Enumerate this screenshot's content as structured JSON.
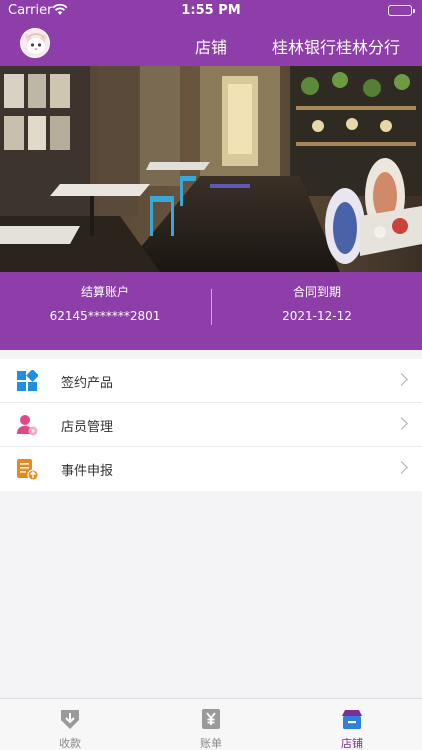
{
  "status_bar": {
    "carrier": "Carrier",
    "time": "1:55 PM"
  },
  "nav": {
    "title": "店铺",
    "bank_name": "桂林银行桂林分行"
  },
  "account": {
    "settlement_label": "结算账户",
    "settlement_value": "62145*******2801",
    "contract_label": "合同到期",
    "contract_value": "2021-12-12"
  },
  "menu": {
    "items": [
      {
        "label": "签约产品",
        "icon": "grid-icon"
      },
      {
        "label": "店员管理",
        "icon": "staff-icon"
      },
      {
        "label": "事件申报",
        "icon": "report-icon"
      }
    ]
  },
  "tabs": {
    "items": [
      {
        "label": "收款",
        "icon": "download-receive-icon"
      },
      {
        "label": "账单",
        "icon": "bill-yen-icon"
      },
      {
        "label": "店铺",
        "icon": "store-icon",
        "active": true
      }
    ]
  },
  "colors": {
    "brand_purple": "#8e3ea8",
    "active_tab": "#7b2f96"
  }
}
